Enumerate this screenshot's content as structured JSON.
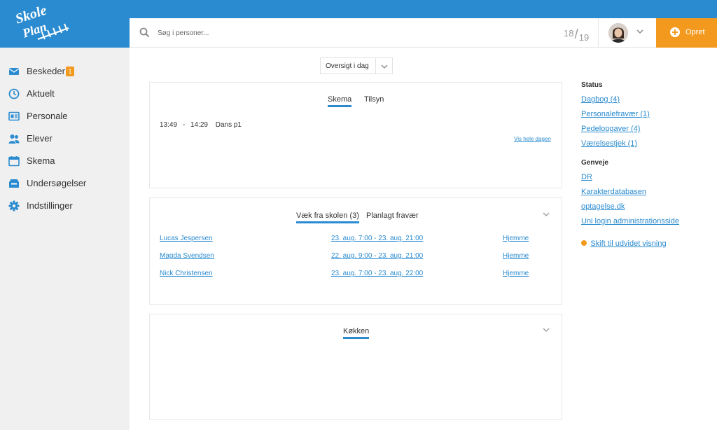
{
  "logo": {
    "text": "Skole Plan"
  },
  "colors": {
    "brand_blue": "#2a8bd0",
    "accent_orange": "#f39a1e",
    "sidebar_bg": "#f0f0f0"
  },
  "sidebar": {
    "items": [
      {
        "label": "Beskeder",
        "icon": "envelope-icon",
        "badge": "1"
      },
      {
        "label": "Aktuelt",
        "icon": "clock-icon"
      },
      {
        "label": "Personale",
        "icon": "id-card-icon"
      },
      {
        "label": "Elever",
        "icon": "users-icon"
      },
      {
        "label": "Skema",
        "icon": "calendar-icon"
      },
      {
        "label": "Undersøgelser",
        "icon": "inbox-icon"
      },
      {
        "label": "Indstillinger",
        "icon": "gear-icon"
      }
    ]
  },
  "topbar": {
    "search_placeholder": "Søg i personer...",
    "week_a": "18",
    "week_sep": "/",
    "week_b": "19",
    "create_label": "Opret"
  },
  "overview": {
    "label": "Oversigt i dag"
  },
  "schedule_card": {
    "tabs": [
      "Skema",
      "Tilsyn"
    ],
    "entry_start": "13:49",
    "entry_dash": "-",
    "entry_end": "14:29",
    "entry_title": "Dans p1",
    "show_day_link": "Vis hele dagen"
  },
  "absence_card": {
    "tabs": [
      "Væk fra skolen (3)",
      "Planlagt fravær"
    ],
    "rows": [
      {
        "name": "Lucas Jespersen",
        "period": "23. aug. 7:00 - 23. aug. 21:00",
        "reason": "Hjemme"
      },
      {
        "name": "Magda Svendsen",
        "period": "22. aug. 9:00 - 23. aug. 21:00",
        "reason": "Hjemme"
      },
      {
        "name": "Nick Christensen",
        "period": "23. aug. 7:00 - 23. aug. 22:00",
        "reason": "Hjemme"
      }
    ]
  },
  "kitchen_card": {
    "tab": "Køkken"
  },
  "right_panel": {
    "status_heading": "Status",
    "status_links": [
      "Dagbog (4)",
      "Personalefravær (1)",
      "Pedelopgaver (4)",
      "Værelsestjek (1)"
    ],
    "shortcuts_heading": "Genveje",
    "shortcut_links": [
      "DR",
      "Karakterdatabasen",
      "optagelse.dk",
      "Uni login administrationsside"
    ],
    "expand_link": "Skift til udvidet visning"
  }
}
